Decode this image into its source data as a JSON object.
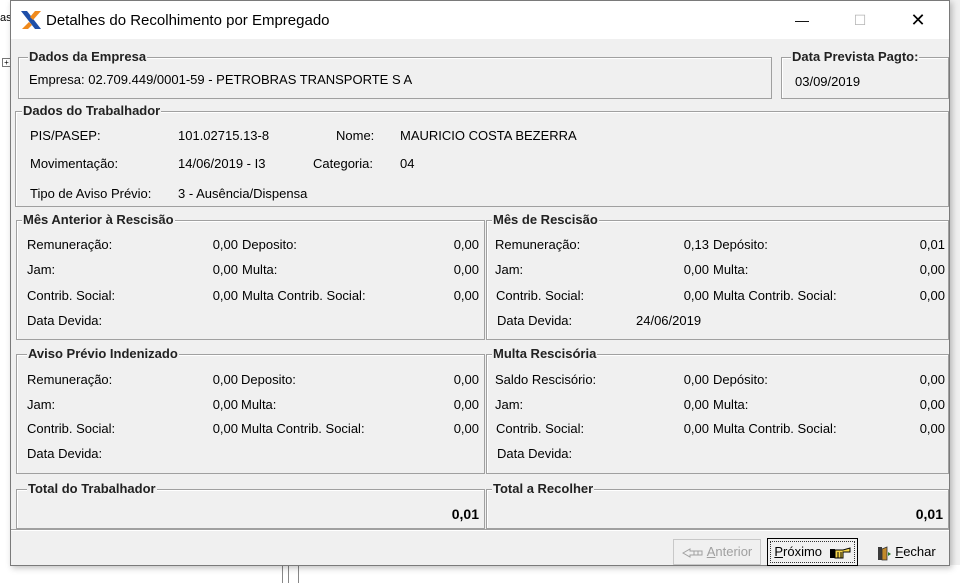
{
  "window": {
    "title": "Detalhes do Recolhimento por Empregado"
  },
  "titlebar": {
    "minimize": "—",
    "maximize": "☐",
    "close": "✕"
  },
  "background": {
    "fragment": "as",
    "tree_toggle": "+"
  },
  "empresa": {
    "legend": "Dados da Empresa",
    "text": "Empresa: 02.709.449/0001-59 - PETROBRAS TRANSPORTE S A"
  },
  "data_prevista": {
    "legend": "Data Prevista Pagto:",
    "value": "03/09/2019"
  },
  "trabalhador": {
    "legend": "Dados do Trabalhador",
    "pis_label": "PIS/PASEP:",
    "pis_value": "101.02715.13-8",
    "nome_label": "Nome:",
    "nome_value": "MAURICIO COSTA BEZERRA",
    "mov_label": "Movimentação:",
    "mov_value": "14/06/2019 - I3",
    "cat_label": "Categoria:",
    "cat_value": "04",
    "aviso_label": "Tipo de Aviso Prévio:",
    "aviso_value": "3 - Ausência/Dispensa"
  },
  "mes_anterior": {
    "legend": "Mês Anterior à Rescisão",
    "rem_label": "Remuneração:",
    "rem_value": "0,00",
    "jam_label": "Jam:",
    "jam_value": "0,00",
    "cs_label": "Contrib. Social:",
    "cs_value": "0,00",
    "dd_label": "Data Devida:",
    "dd_value": "",
    "dep_label": "Deposito:",
    "dep_value": "0,00",
    "multa_label": "Multa:",
    "multa_value": "0,00",
    "mcs_label": "Multa Contrib. Social:",
    "mcs_value": "0,00"
  },
  "mes_rescisao": {
    "legend": "Mês de Rescisão",
    "rem_label": "Remuneração:",
    "rem_value": "0,13",
    "jam_label": "Jam:",
    "jam_value": "0,00",
    "cs_label": "Contrib. Social:",
    "cs_value": "0,00",
    "dd_label": "Data Devida:",
    "dd_value": "24/06/2019",
    "dep_label": "Depósito:",
    "dep_value": "0,01",
    "multa_label": "Multa:",
    "multa_value": "0,00",
    "mcs_label": "Multa Contrib. Social:",
    "mcs_value": "0,00"
  },
  "aviso_previo": {
    "legend": "Aviso Prévio Indenizado",
    "rem_label": "Remuneração:",
    "rem_value": "0,00",
    "jam_label": "Jam:",
    "jam_value": "0,00",
    "cs_label": "Contrib. Social:",
    "cs_value": "0,00",
    "dd_label": "Data Devida:",
    "dd_value": "",
    "dep_label": "Deposito:",
    "dep_value": "0,00",
    "multa_label": "Multa:",
    "multa_value": "0,00",
    "mcs_label": "Multa Contrib. Social:",
    "mcs_value": "0,00"
  },
  "multa_rescisoria": {
    "legend": "Multa Rescisória",
    "rem_label": "Saldo Rescisório:",
    "rem_value": "0,00",
    "jam_label": "Jam:",
    "jam_value": "0,00",
    "cs_label": "Contrib. Social:",
    "cs_value": "0,00",
    "dd_label": "Data Devida:",
    "dd_value": "",
    "dep_label": "Depósito:",
    "dep_value": "0,00",
    "multa_label": "Multa:",
    "multa_value": "0,00",
    "mcs_label": "Multa Contrib. Social:",
    "mcs_value": "0,00"
  },
  "total_trabalhador": {
    "legend": "Total do Trabalhador",
    "value": "0,01"
  },
  "total_recolher": {
    "legend": "Total a Recolher",
    "value": "0,01"
  },
  "buttons": {
    "anterior_mn": "A",
    "anterior_rest": "nterior",
    "proximo_mn": "P",
    "proximo_rest": "róximo",
    "fechar_mn": "F",
    "fechar_rest": "echar"
  },
  "icons": {
    "app": "caixa-x-logo",
    "anterior": "hand-left-icon",
    "proximo": "hand-right-icon",
    "fechar": "exit-door-icon"
  },
  "colors": {
    "logo_blue": "#1f4fa8",
    "logo_orange": "#f08a1c",
    "disabled_text": "#a0a0a0"
  }
}
